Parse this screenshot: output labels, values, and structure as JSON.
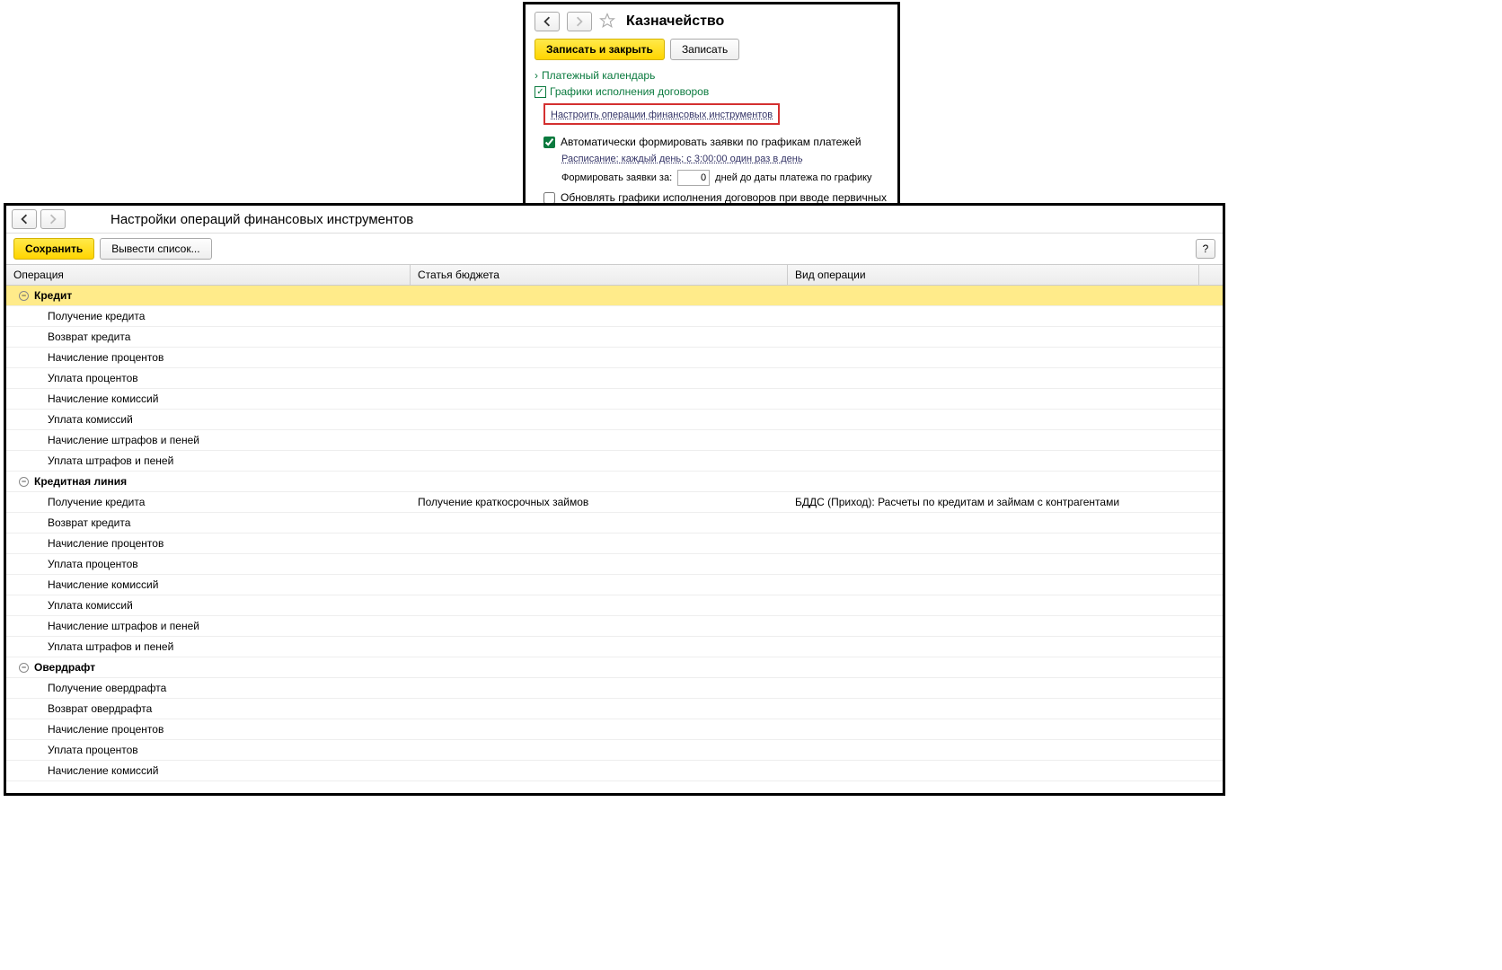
{
  "top": {
    "title": "Казначейство",
    "save_close": "Записать и закрыть",
    "save": "Записать",
    "payment_calendar": "Платежный календарь",
    "schedules": "Графики исполнения договоров",
    "configure_link": "Настроить операции финансовых инструментов",
    "auto_form": "Автоматически формировать заявки по графикам платежей",
    "schedule_link": "Расписание: каждый день; с 3:00:00 один раз в день",
    "form_for_label": "Формировать заявки за:",
    "days_value": "0",
    "days_after": "дней до даты платежа по графику",
    "update_schedules": "Обновлять графики исполнения договоров при вводе первичных документов"
  },
  "bottom": {
    "title": "Настройки операций финансовых инструментов",
    "save_btn": "Сохранить",
    "export_btn": "Вывести список...",
    "help": "?",
    "columns": {
      "operation": "Операция",
      "budget": "Статья бюджета",
      "type": "Вид операции"
    },
    "groups": [
      {
        "name": "Кредит",
        "selected": true,
        "rows": [
          {
            "op": "Получение кредита",
            "budget": "",
            "type": ""
          },
          {
            "op": "Возврат кредита",
            "budget": "",
            "type": ""
          },
          {
            "op": "Начисление процентов",
            "budget": "",
            "type": ""
          },
          {
            "op": "Уплата процентов",
            "budget": "",
            "type": ""
          },
          {
            "op": "Начисление комиссий",
            "budget": "",
            "type": ""
          },
          {
            "op": "Уплата комиссий",
            "budget": "",
            "type": ""
          },
          {
            "op": "Начисление штрафов и пеней",
            "budget": "",
            "type": ""
          },
          {
            "op": "Уплата штрафов и пеней",
            "budget": "",
            "type": ""
          }
        ]
      },
      {
        "name": "Кредитная линия",
        "selected": false,
        "rows": [
          {
            "op": "Получение кредита",
            "budget": "Получение краткосрочных займов",
            "type": "БДДС (Приход): Расчеты по кредитам и займам с контрагентами"
          },
          {
            "op": "Возврат кредита",
            "budget": "",
            "type": ""
          },
          {
            "op": "Начисление процентов",
            "budget": "",
            "type": ""
          },
          {
            "op": "Уплата процентов",
            "budget": "",
            "type": ""
          },
          {
            "op": "Начисление комиссий",
            "budget": "",
            "type": ""
          },
          {
            "op": "Уплата комиссий",
            "budget": "",
            "type": ""
          },
          {
            "op": "Начисление штрафов и пеней",
            "budget": "",
            "type": ""
          },
          {
            "op": "Уплата штрафов и пеней",
            "budget": "",
            "type": ""
          }
        ]
      },
      {
        "name": "Овердрафт",
        "selected": false,
        "rows": [
          {
            "op": "Получение овердрафта",
            "budget": "",
            "type": ""
          },
          {
            "op": "Возврат овердрафта",
            "budget": "",
            "type": ""
          },
          {
            "op": "Начисление процентов",
            "budget": "",
            "type": ""
          },
          {
            "op": "Уплата процентов",
            "budget": "",
            "type": ""
          },
          {
            "op": "Начисление комиссий",
            "budget": "",
            "type": ""
          }
        ]
      }
    ]
  }
}
